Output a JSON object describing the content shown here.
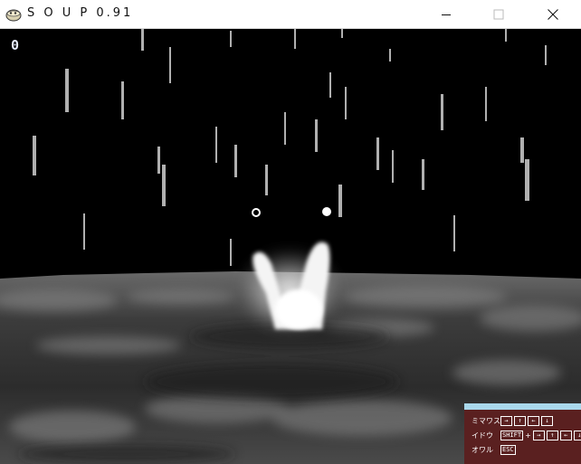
{
  "window": {
    "title": "S O U P 0.91",
    "app_icon": "soup-bowl-icon",
    "buttons": [
      "minimize-icon",
      "maximize-icon",
      "close-icon"
    ]
  },
  "game": {
    "score": "0",
    "scene": "rain-over-dark-soup-surface"
  },
  "controls": {
    "rows": [
      {
        "label": "ミマワス",
        "keys": [
          "→",
          "↑",
          "←",
          "↓"
        ]
      },
      {
        "label": "イドウ",
        "modifier": "SHIFT",
        "plus": "+",
        "keys": [
          "→",
          "↑",
          "←",
          "↓"
        ]
      },
      {
        "label": "オワル",
        "keys": [
          "ESC"
        ]
      }
    ]
  },
  "colors": {
    "panel_bg": "#5a2020",
    "panel_top": "#a9d8ec",
    "score_text": "#e6ecff"
  }
}
